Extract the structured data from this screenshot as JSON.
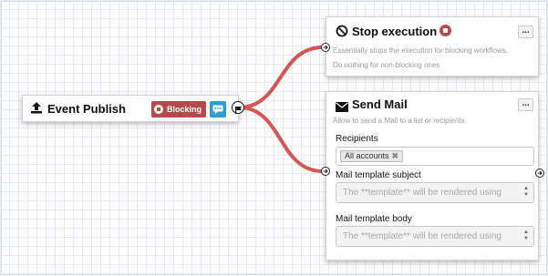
{
  "colors": {
    "wire": "#d65553",
    "blocking": "#b44a4a",
    "chat": "#2a9fd6"
  },
  "event_node": {
    "title": "Event Publish",
    "icon": "upload-icon",
    "badge": "Blocking",
    "chat_icon": "chat-icon",
    "out_port_icon": "flag-icon"
  },
  "stop_node": {
    "title": "Stop execution",
    "icon": "ban-icon",
    "stop_icon": "stop-icon",
    "menu": "...",
    "desc_line1": "Essentially stops the execution for blocking workflows.",
    "desc_line2": "Do nothing for non-blocking ones"
  },
  "mail_node": {
    "title": "Send Mail",
    "icon": "envelope-icon",
    "menu": "...",
    "desc": "Allow to send a Mail to a list or recipients",
    "recipients_label": "Recipients",
    "recipients_tag": "All accounts",
    "subject_label": "Mail template subject",
    "subject_placeholder": "The **template** will be rendered using",
    "body_label": "Mail template body",
    "body_placeholder": "The **template** will be rendered using"
  }
}
